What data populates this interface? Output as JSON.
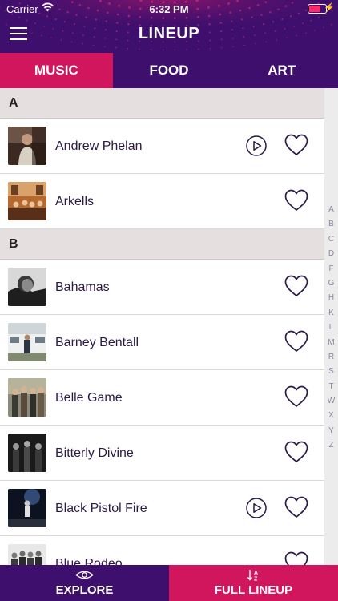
{
  "status_bar": {
    "carrier": "Carrier",
    "time": "6:32 PM"
  },
  "header": {
    "title": "LINEUP",
    "menu_icon": "hamburger-menu-icon"
  },
  "tabs": [
    {
      "label": "MUSIC",
      "active": true
    },
    {
      "label": "FOOD",
      "active": false
    },
    {
      "label": "ART",
      "active": false
    }
  ],
  "sections": [
    {
      "letter": "A",
      "artists": [
        {
          "name": "Andrew Phelan",
          "has_play": true
        },
        {
          "name": "Arkells",
          "has_play": false
        }
      ]
    },
    {
      "letter": "B",
      "artists": [
        {
          "name": "Bahamas",
          "has_play": false
        },
        {
          "name": "Barney Bentall",
          "has_play": false
        },
        {
          "name": "Belle Game",
          "has_play": false
        },
        {
          "name": "Bitterly Divine",
          "has_play": false
        },
        {
          "name": "Black Pistol Fire",
          "has_play": true
        },
        {
          "name": "Blue Rodeo",
          "has_play": false
        }
      ]
    }
  ],
  "alpha_index": [
    "A",
    "B",
    "C",
    "D",
    "F",
    "G",
    "H",
    "K",
    "L",
    "M",
    "R",
    "S",
    "T",
    "W",
    "X",
    "Y",
    "Z"
  ],
  "bottom_bar": {
    "explore": {
      "label": "EXPLORE",
      "icon": "eye-icon"
    },
    "full_lineup": {
      "label": "FULL LINEUP",
      "icon": "sort-az-icon"
    }
  },
  "colors": {
    "purple": "#3e0f6d",
    "magenta": "#d1165e",
    "section_bg": "#e5e0df",
    "text": "#2b1a45"
  }
}
